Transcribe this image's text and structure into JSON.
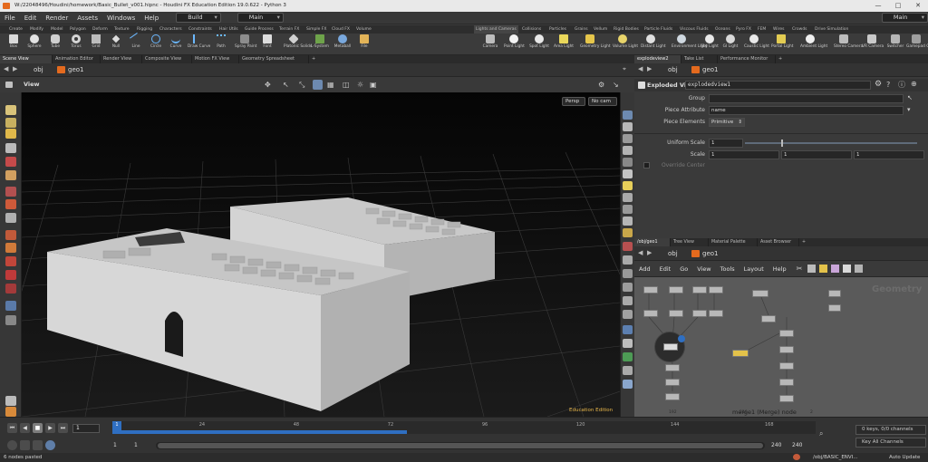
{
  "window": {
    "title": "W:/22048496/Houdini/homework/Basic_Bullet_v001.hipnc - Houdini FX Education Edition 19.0.622 - Python 3",
    "controls": [
      "—",
      "□",
      "✕"
    ]
  },
  "menubar": {
    "items": [
      "File",
      "Edit",
      "Render",
      "Assets",
      "Windows",
      "Help"
    ],
    "desktop": "Build",
    "context": "Main",
    "desktop_right": "Main"
  },
  "shelf": {
    "left_tabs": [
      "Create",
      "Modify",
      "Model",
      "Polygon",
      "Deform",
      "Texture",
      "Rigging",
      "Characters",
      "Constraints",
      "Hair Utils",
      "Guide Process",
      "Terrain FX",
      "Simple FX",
      "Cloud FX",
      "Volume"
    ],
    "right_tabs": [
      "Lights and Cameras",
      "Collisions",
      "Particles",
      "Grains",
      "Vellum",
      "Rigid Bodies",
      "Particle Fluids",
      "Viscous Fluids",
      "Oceans",
      "Pyro FX",
      "FEM",
      "Wires",
      "Crowds",
      "Drive Simulation"
    ],
    "left_tools": [
      {
        "label": "Box",
        "icon": "box-icon"
      },
      {
        "label": "Sphere",
        "icon": "sphere-icon"
      },
      {
        "label": "Tube",
        "icon": "tube-icon"
      },
      {
        "label": "Torus",
        "icon": "torus-icon"
      },
      {
        "label": "Grid",
        "icon": "grid-icon"
      },
      {
        "label": "Null",
        "icon": "null-icon"
      },
      {
        "label": "Line",
        "icon": "line-icon"
      },
      {
        "label": "Circle",
        "icon": "circle-icon"
      },
      {
        "label": "Curve",
        "icon": "curve-icon"
      },
      {
        "label": "Draw Curve",
        "icon": "draw-curve-icon"
      },
      {
        "label": "Path",
        "icon": "path-icon"
      },
      {
        "label": "Spray Paint",
        "icon": "spray-paint-icon"
      },
      {
        "label": "Font",
        "icon": "font-icon"
      },
      {
        "label": "Platonic Solids",
        "icon": "platonic-icon"
      },
      {
        "label": "L-System",
        "icon": "lsystem-icon"
      },
      {
        "label": "Metaball",
        "icon": "metaball-icon"
      },
      {
        "label": "File",
        "icon": "file-icon"
      }
    ],
    "right_tools": [
      {
        "label": "Camera",
        "icon": "camera-icon"
      },
      {
        "label": "Point Light",
        "icon": "point-light-icon"
      },
      {
        "label": "Spot Light",
        "icon": "spot-light-icon"
      },
      {
        "label": "Area Light",
        "icon": "area-light-icon"
      },
      {
        "label": "Geometry Light",
        "icon": "geometry-light-icon"
      },
      {
        "label": "Volume Light",
        "icon": "volume-light-icon"
      },
      {
        "label": "Distant Light",
        "icon": "distant-light-icon"
      },
      {
        "label": "Environment Light",
        "icon": "environment-light-icon"
      },
      {
        "label": "Sky Light",
        "icon": "sky-light-icon"
      },
      {
        "label": "GI Light",
        "icon": "gi-light-icon"
      },
      {
        "label": "Caustic Light",
        "icon": "caustic-light-icon"
      },
      {
        "label": "Portal Light",
        "icon": "portal-light-icon"
      },
      {
        "label": "Ambient Light",
        "icon": "ambient-light-icon"
      },
      {
        "label": "Stereo Camera",
        "icon": "stereo-camera-icon"
      },
      {
        "label": "VR Camera",
        "icon": "vr-camera-icon"
      },
      {
        "label": "Switcher",
        "icon": "switcher-icon"
      },
      {
        "label": "Gamepad Cam",
        "icon": "gamepad-icon"
      }
    ]
  },
  "left_pane": {
    "tabs": [
      "Scene View",
      "Animation Editor",
      "Render View",
      "Composite View",
      "Motion FX View",
      "Geometry Spreadsheet"
    ],
    "path": [
      "obj",
      "geo1"
    ],
    "viewport_label": "View",
    "camera_persp": "Persp",
    "camera_none": "No cam",
    "watermark": "Education Edition"
  },
  "param_pane": {
    "tabs": [
      "explodeview2",
      "Take List",
      "Performance Monitor"
    ],
    "path": [
      "obj",
      "geo1"
    ],
    "node_type": "Exploded View",
    "node_name": "explodedview1",
    "params": {
      "group_label": "Group",
      "group_value": "",
      "piece_attr_label": "Piece Attribute",
      "piece_attr_value": "name",
      "piece_elements_label": "Piece Elements",
      "piece_elements_value": "Primitive",
      "uniform_scale_label": "Uniform Scale",
      "uniform_scale_value": "1",
      "scale_label": "Scale",
      "scale_values": [
        "1",
        "1",
        "1"
      ],
      "override_center_label": "Override Center"
    }
  },
  "network_pane": {
    "tabs": [
      "/obj/geo1",
      "Tree View",
      "Material Palette",
      "Asset Browser"
    ],
    "path": [
      "obj",
      "geo1"
    ],
    "menu": [
      "Add",
      "Edit",
      "Go",
      "View",
      "Tools",
      "Layout",
      "Help"
    ],
    "context_label": "Geometry",
    "status": "merge1 (Merge) node",
    "ruler": [
      "192",
      "216",
      "2"
    ]
  },
  "timeline": {
    "current_frame": "1",
    "start_frame": "1",
    "start_frame2": "1",
    "end_frame": "240",
    "end_frame2": "240",
    "ticks": [
      "1",
      "24",
      "48",
      "72",
      "96",
      "120",
      "144",
      "168"
    ],
    "playhead_frame": 1,
    "range_end": 240,
    "keys_info": "0 keys, 0/0 channels",
    "key_all": "Key All Channels",
    "auto_update": "Auto Update"
  },
  "statusbar": {
    "message": "6 nodes pasted",
    "path": "/obj/BASIC_ENVI..."
  },
  "colors": {
    "accent": "#ea7a1a",
    "timeline_blue": "#2f6fc2",
    "node_body": "#b8b8b8",
    "network_bg": "#5a5a5a"
  }
}
